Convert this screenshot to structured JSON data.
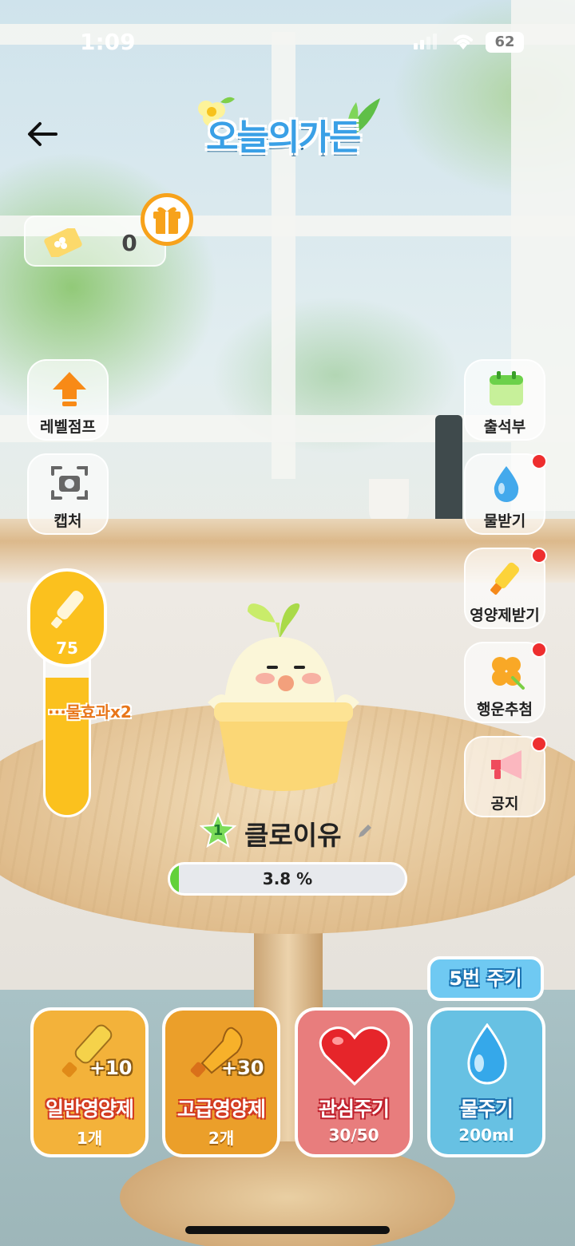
{
  "status_bar": {
    "time": "1:09",
    "battery": "62"
  },
  "header": {
    "title": "오늘의가든"
  },
  "ticket": {
    "count": "0"
  },
  "left_menu": [
    {
      "label": "레벨점프"
    },
    {
      "label": "캡처"
    }
  ],
  "right_menu": [
    {
      "label": "출석부",
      "has_badge": false
    },
    {
      "label": "물받기",
      "has_badge": true
    },
    {
      "label": "영양제받기",
      "has_badge": true
    },
    {
      "label": "행운추첨",
      "has_badge": true
    },
    {
      "label": "공지",
      "has_badge": true
    }
  ],
  "nutrient_gauge": {
    "value": "75",
    "marker_label": "물효과x2",
    "fill_fraction": 0.76
  },
  "plant": {
    "level": "1",
    "name": "클로이유"
  },
  "progress": {
    "text": "3.8 %",
    "value_percent": 3.8
  },
  "water_count_badge": "5번 주기",
  "actions": [
    {
      "label": "일반영양제",
      "sub": "1개",
      "bonus": "+10",
      "color": "#f3b23a"
    },
    {
      "label": "고급영양제",
      "sub": "2개",
      "bonus": "+30",
      "color": "#eb9f2a"
    },
    {
      "label": "관심주기",
      "sub": "30/50",
      "color": "#e87d7d"
    },
    {
      "label": "물주기",
      "sub": "200ml",
      "color": "#67c1e3"
    }
  ],
  "colors": {
    "accent_yellow": "#fbc11e",
    "progress_green": "#62d13a",
    "badge_red": "#ee2e2e",
    "water_blue": "#6fc9f2"
  }
}
